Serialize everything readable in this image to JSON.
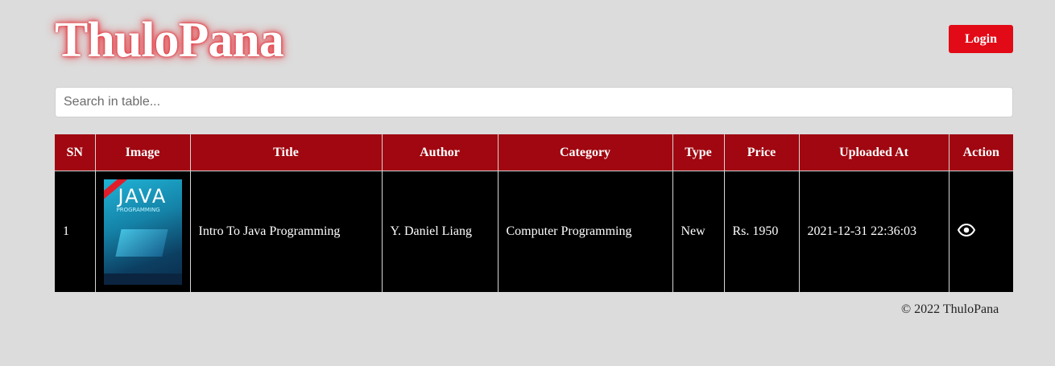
{
  "header": {
    "logo": "ThuloPana",
    "login_label": "Login"
  },
  "search": {
    "placeholder": "Search in table...",
    "value": ""
  },
  "table": {
    "columns": [
      "SN",
      "Image",
      "Title",
      "Author",
      "Category",
      "Type",
      "Price",
      "Uploaded At",
      "Action"
    ],
    "rows": [
      {
        "sn": "1",
        "image_icon": "book-cover-java",
        "title": "Intro To Java Programming",
        "author": "Y. Daniel Liang",
        "category": "Computer Programming",
        "type": "New",
        "price": "Rs. 1950",
        "uploaded_at": "2021-12-31 22:36:03",
        "action_icon": "eye-icon"
      }
    ]
  },
  "footer": {
    "text": "© 2022 ThuloPana"
  },
  "colors": {
    "background": "#dcdcdc",
    "header_row": "#a00710",
    "body_row": "#000000",
    "login_button": "#e20a16",
    "logo_glow": "#e8323a"
  }
}
